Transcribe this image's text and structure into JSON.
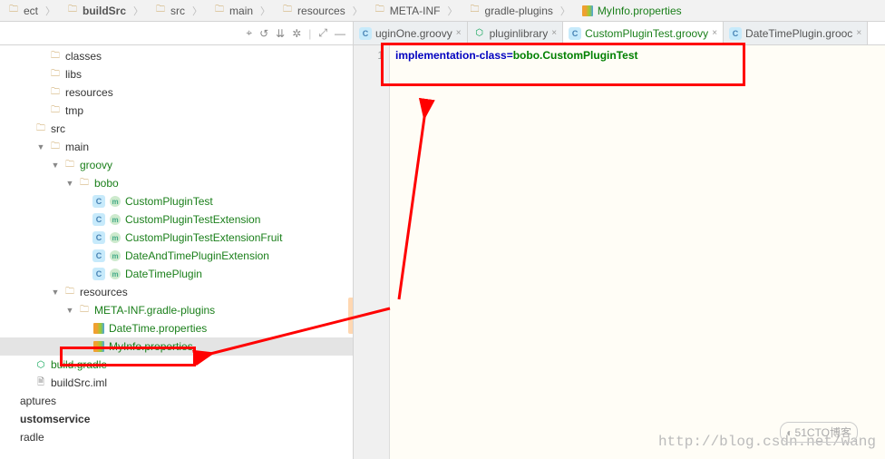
{
  "breadcrumb": [
    {
      "icon": "folder",
      "label": "ect"
    },
    {
      "icon": "folder",
      "label": "buildSrc",
      "bold": true
    },
    {
      "icon": "folder",
      "label": "src"
    },
    {
      "icon": "folder",
      "label": "main"
    },
    {
      "icon": "folder",
      "label": "resources"
    },
    {
      "icon": "folder",
      "label": "META-INF"
    },
    {
      "icon": "folder",
      "label": "gradle-plugins"
    },
    {
      "icon": "props",
      "label": "MyInfo.properties",
      "active": true
    }
  ],
  "toolbar": {
    "crosshair": "⌖",
    "sync": "↺",
    "collapse": "⇊",
    "gear": "✲",
    "expand": "⤢",
    "hide": "—"
  },
  "tabs": [
    {
      "icon": "class",
      "label": "uginOne.groovy",
      "active": false
    },
    {
      "icon": "gradle",
      "label": "pluginlibrary",
      "active": false
    },
    {
      "icon": "class",
      "label": "CustomPluginTest.groovy",
      "active": true
    },
    {
      "icon": "class",
      "label": "DateTimePlugin.grooc",
      "active": false
    }
  ],
  "tree": [
    {
      "d": 1,
      "arrow": "",
      "icon": "folder",
      "label": "classes",
      "cls": ""
    },
    {
      "d": 1,
      "arrow": "",
      "icon": "folder",
      "label": "libs",
      "cls": ""
    },
    {
      "d": 1,
      "arrow": "",
      "icon": "folder",
      "label": "resources",
      "cls": ""
    },
    {
      "d": 1,
      "arrow": "",
      "icon": "folder",
      "label": "tmp",
      "cls": ""
    },
    {
      "d": 0,
      "arrow": "",
      "icon": "folder",
      "label": "src",
      "cls": ""
    },
    {
      "d": 1,
      "arrow": "▼",
      "icon": "folder",
      "label": "main",
      "cls": ""
    },
    {
      "d": 2,
      "arrow": "▼",
      "icon": "folder",
      "label": "groovy",
      "cls": "green-label"
    },
    {
      "d": 3,
      "arrow": "▼",
      "icon": "folder",
      "label": "bobo",
      "cls": "green-label"
    },
    {
      "d": 4,
      "arrow": "",
      "icon": "class",
      "icon2": "m",
      "label": "CustomPluginTest",
      "cls": "green-label"
    },
    {
      "d": 4,
      "arrow": "",
      "icon": "class",
      "icon2": "m",
      "label": "CustomPluginTestExtension",
      "cls": "green-label"
    },
    {
      "d": 4,
      "arrow": "",
      "icon": "class",
      "icon2": "m",
      "label": "CustomPluginTestExtensionFruit",
      "cls": "green-label"
    },
    {
      "d": 4,
      "arrow": "",
      "icon": "class",
      "icon2": "m",
      "label": "DateAndTimePluginExtension",
      "cls": "green-label"
    },
    {
      "d": 4,
      "arrow": "",
      "icon": "class",
      "icon2": "m",
      "label": "DateTimePlugin",
      "cls": "green-label"
    },
    {
      "d": 2,
      "arrow": "▼",
      "icon": "folder",
      "label": "resources",
      "cls": ""
    },
    {
      "d": 3,
      "arrow": "▼",
      "icon": "folder",
      "label": "META-INF.gradle-plugins",
      "cls": "green-label"
    },
    {
      "d": 4,
      "arrow": "",
      "icon": "props",
      "label": "DateTime.properties",
      "cls": "green-label"
    },
    {
      "d": 4,
      "arrow": "",
      "icon": "props",
      "label": "MyInfo.properties",
      "cls": "green-label",
      "sel": true
    },
    {
      "d": 0,
      "arrow": "",
      "icon": "gradle",
      "label": "build.gradle",
      "cls": "green-label"
    },
    {
      "d": 0,
      "arrow": "",
      "icon": "file",
      "label": "buildSrc.iml",
      "cls": ""
    },
    {
      "d": -1,
      "arrow": "",
      "icon": "",
      "label": "aptures",
      "cls": ""
    },
    {
      "d": -1,
      "arrow": "",
      "icon": "",
      "label": "ustomservice",
      "cls": "bold"
    },
    {
      "d": -1,
      "arrow": "",
      "icon": "",
      "label": "radle",
      "cls": ""
    }
  ],
  "editor": {
    "lineno": "1",
    "key": "implementation-class",
    "sep": "=",
    "val1": "bobo",
    "dot": ".",
    "val2": "CustomPluginTest"
  },
  "watermark": "http://blog.csdn.net/wang",
  "stamp": "51CTO博客"
}
